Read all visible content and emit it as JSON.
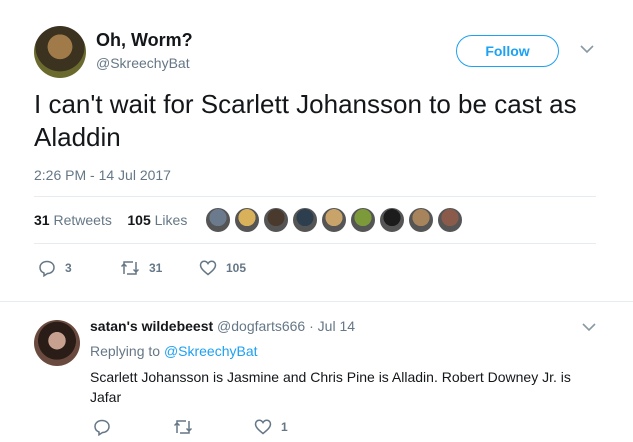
{
  "tweet": {
    "display_name": "Oh, Worm?",
    "handle": "@SkreechyBat",
    "follow_label": "Follow",
    "text": "I can't wait for Scarlett Johansson to be cast as Aladdin",
    "timestamp": "2:26 PM - 14 Jul 2017",
    "retweets_count": "31",
    "retweets_label": "Retweets",
    "likes_count": "105",
    "likes_label": "Likes",
    "liker_avatar_colors": [
      "#6b7a8c",
      "#d9b15a",
      "#4a3a2e",
      "#2d3e4f",
      "#c9a46a",
      "#7c9a3a",
      "#1c1c1c",
      "#a8845c",
      "#8a5a4a"
    ],
    "actions": {
      "reply_count": "3",
      "retweet_count": "31",
      "like_count": "105"
    }
  },
  "reply": {
    "display_name": "satan's wildebeest",
    "handle": "@dogfarts666",
    "separator": "·",
    "date": "Jul 14",
    "replying_prefix": "Replying to",
    "replying_to": "@SkreechyBat",
    "text": "Scarlett Johansson is Jasmine and Chris Pine is Alladin. Robert Downey Jr. is Jafar",
    "actions": {
      "reply_count": "",
      "retweet_count": "",
      "like_count": "1"
    }
  },
  "colors": {
    "accent": "#1da1f2",
    "secondary_text": "#657786",
    "divider": "#e6ecf0"
  },
  "icons": [
    "chevron-down-icon",
    "reply-icon",
    "retweet-icon",
    "heart-icon"
  ]
}
